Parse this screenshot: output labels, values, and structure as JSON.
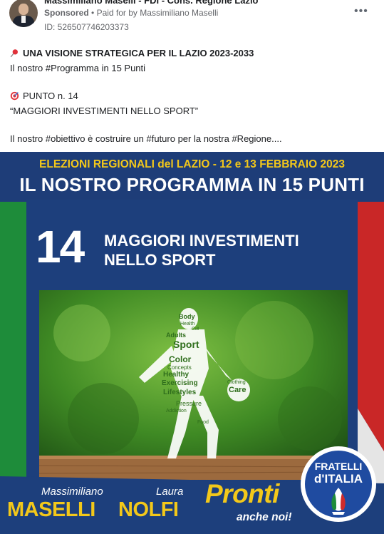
{
  "post": {
    "page_name": "Massimiliano Maselli - FDI - Cons. Regione Lazio",
    "sponsored_label": "Sponsored",
    "paid_by_prefix": "Paid for by",
    "paid_by_name": "Massimiliano Maselli",
    "ad_id": "ID: 526507746203373",
    "more_icon": "more-options-icon",
    "lines": [
      "UNA VISIONE STRATEGICA PER IL LAZIO 2023-2033",
      "Il nostro #Programma in 15 Punti",
      "PUNTO n. 14",
      "“MAGGIORI INVESTIMENTI NELLO SPORT”",
      "Il nostro #obiettivo è costruire un #futuro per la nostra #Regione...."
    ]
  },
  "creative": {
    "elections_line": "ELEZIONI REGIONALI del LAZIO - 12 e 13 FEBBRAIO 2023",
    "program_line": "IL NOSTRO PROGRAMMA IN 15 PUNTI",
    "point_number": "14",
    "point_title_1": "MAGGIORI INVESTIMENTI",
    "point_title_2": "NELLO SPORT",
    "word_cloud": {
      "words": [
        "Body",
        "Health",
        "Cell",
        "Adults",
        "Sport",
        "Color",
        "Concepts",
        "Healthy",
        "Exercising",
        "Lifestyles",
        "Pressure",
        "Clothing",
        "Care",
        "Addiction",
        "Food"
      ]
    },
    "candidate_1": {
      "first": "Massimiliano",
      "last": "MASELLI"
    },
    "candidate_2": {
      "first": "Laura",
      "last": "NOLFI"
    },
    "slogan_1": "Pronti",
    "slogan_2": "anche noi!",
    "logo_line_1": "FRATELLI",
    "logo_line_2": "d'ITALIA"
  },
  "colors": {
    "navy": "#1d3f7c",
    "yellow": "#f3c81a",
    "italian_green": "#1e8c3a",
    "italian_red": "#cf2b2b"
  }
}
